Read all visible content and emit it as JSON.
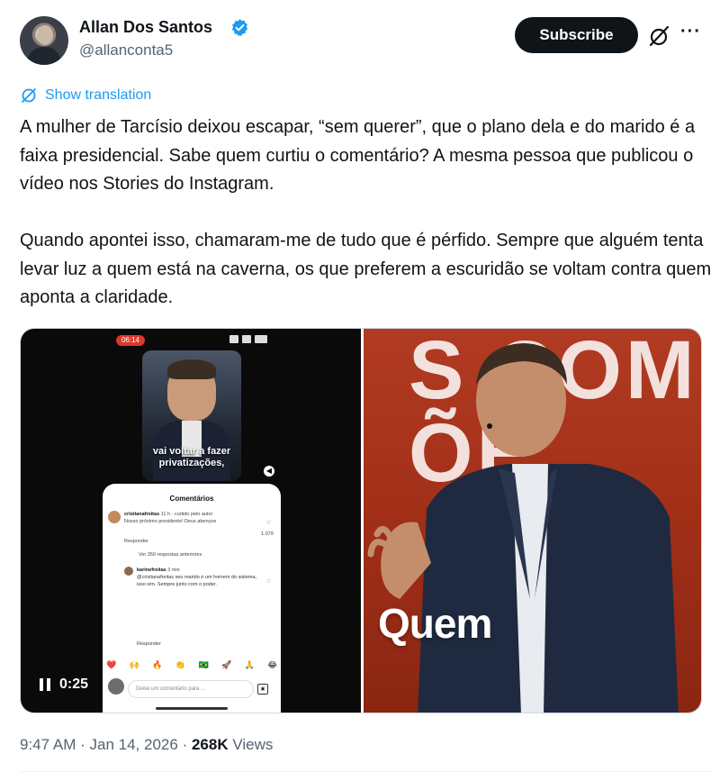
{
  "author": {
    "name": "Allan Dos Santos",
    "handle": "@allanconta5",
    "verified": true,
    "verified_color": "#1d9bf0"
  },
  "header_actions": {
    "subscribe_label": "Subscribe",
    "more_label": "···"
  },
  "translate": {
    "label": "Show translation"
  },
  "tweet": {
    "paragraph_1": "A mulher de Tarcísio deixou escapar, “sem querer”, que o plano dela e do marido é a faixa presidencial. Sabe quem curtiu o comentário? A mesma pessoa que publicou o vídeo nos Stories do Instagram.",
    "paragraph_2": "Quando apontei isso, chamaram-me de tudo que é pérfido. Sempre que alguém tenta levar luz a quem está na caverna, os que preferem a escuridão se voltam contra quem aponta a claridade."
  },
  "media": {
    "left_video": {
      "status_time": "06:14",
      "story_caption": "vai voltar a fazer privatizações,",
      "comments_title": "Comentários",
      "comment_1_user": "cristianafreitas",
      "comment_1_meta": "11 h · curtido pelo autor",
      "comment_1_text": "Nosso próximo presidente! Deus abençoe",
      "comment_1_likes": "1.079",
      "reply_label": "Responder",
      "view_replies": "Ver 359 respostas anteriores",
      "comment_2_user": "karinefreitas",
      "comment_2_meta": "3 min",
      "comment_2_text": "@cristianafreitas seu marido é um homem do sistema, isso sim. Sempre junto com o poder.",
      "comment_2_reply": "Responder",
      "reactions": [
        "❤️",
        "🙌",
        "🔥",
        "👏",
        "🇧🇷",
        "🚀",
        "🙏",
        "😂"
      ],
      "input_placeholder": "Deixe um comentário para ...",
      "elapsed": "0:25"
    },
    "right_video": {
      "background_text": "S COM\nÕE",
      "overlay_word": "Quem"
    }
  },
  "meta": {
    "time": "9:47 AM",
    "separator": "·",
    "date": "Jan 14, 2026",
    "views_count": "268K",
    "views_label": "Views"
  },
  "colors": {
    "link": "#1d9bf0",
    "text": "#0f1419",
    "muted": "#536471",
    "stage_red": "#a33019"
  }
}
